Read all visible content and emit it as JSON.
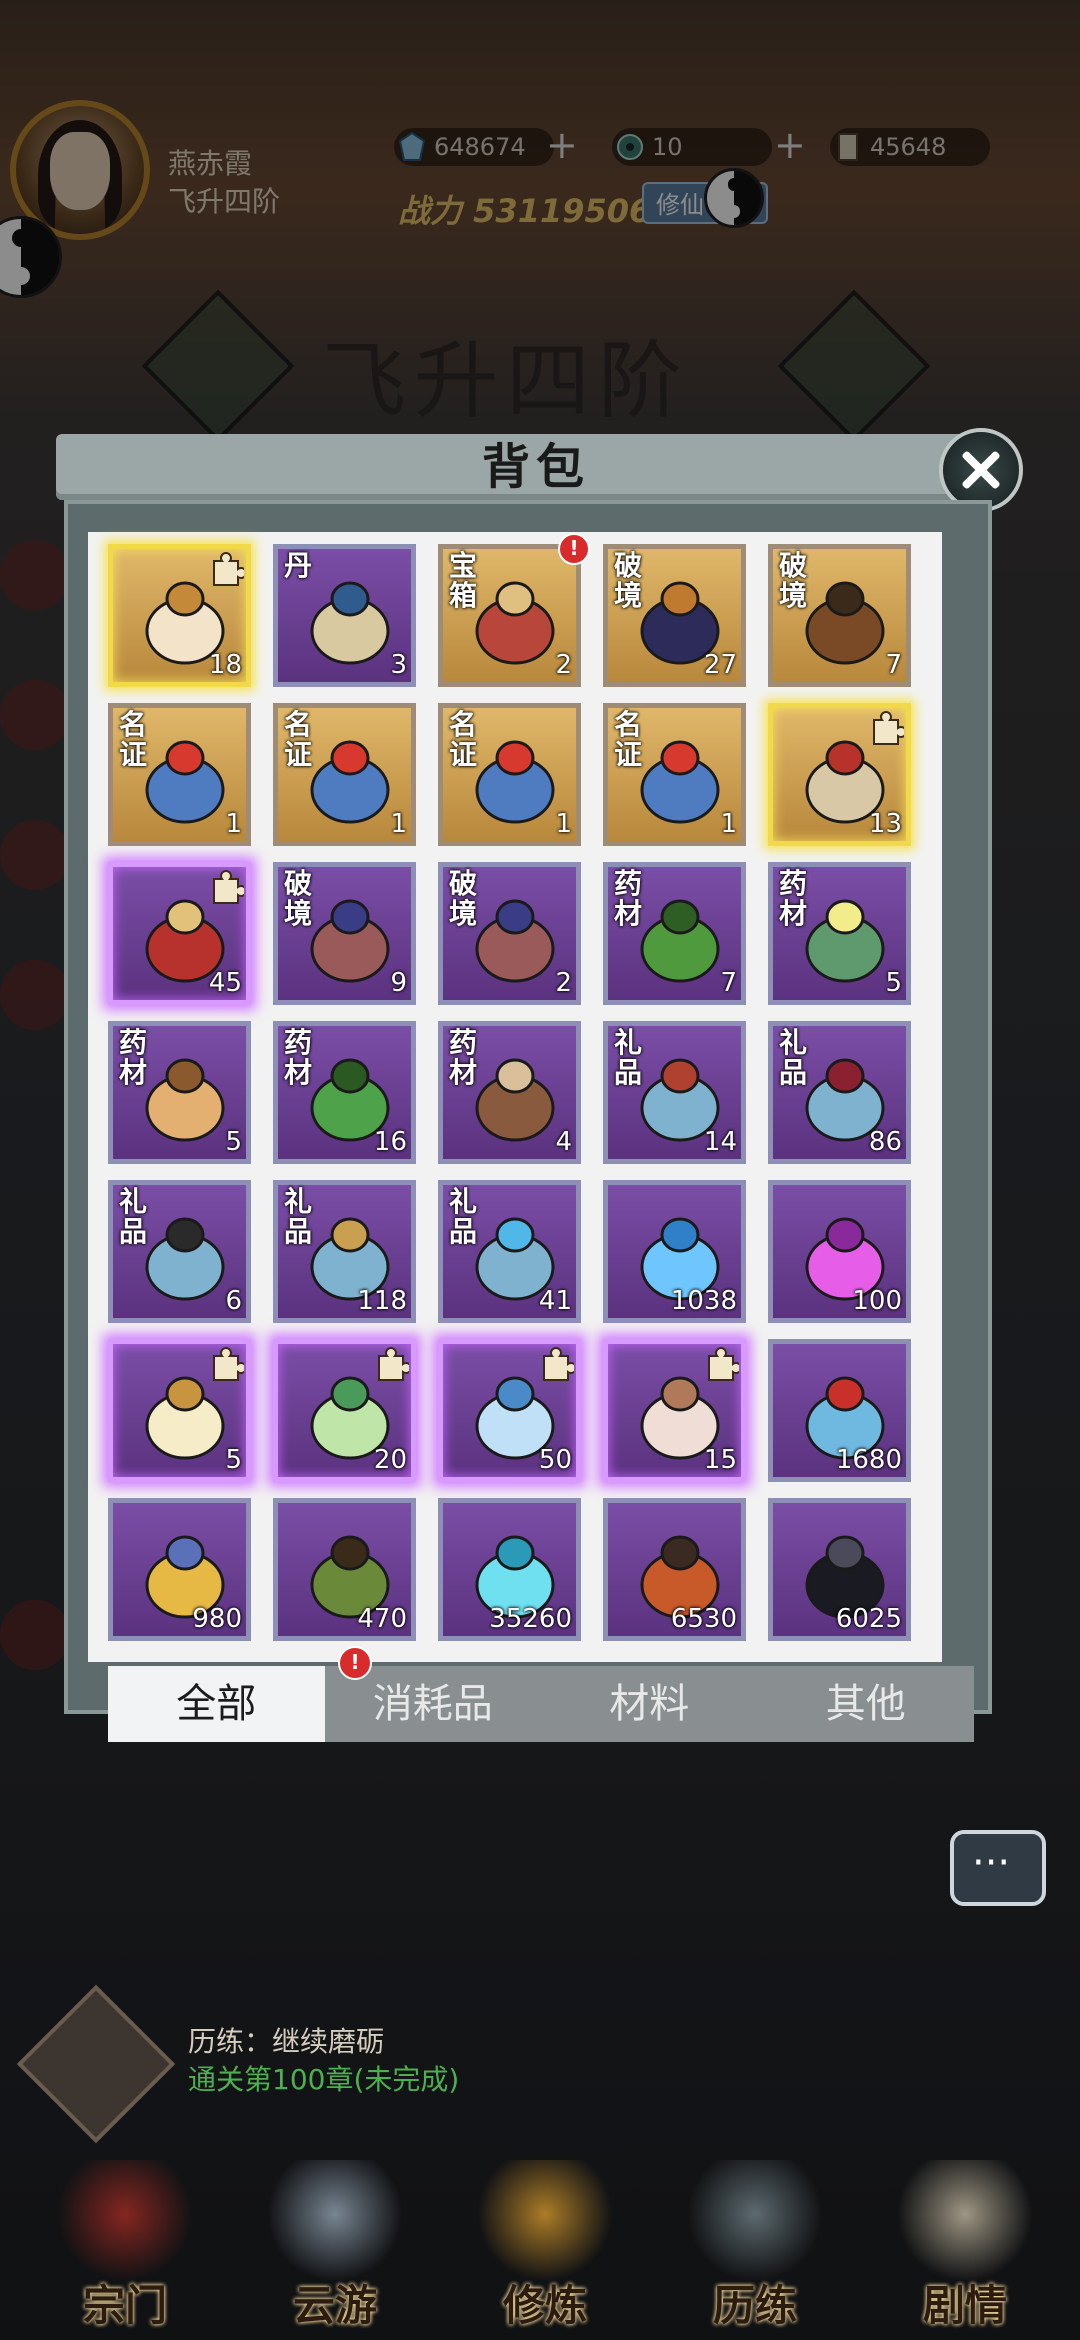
{
  "player": {
    "name": "燕赤霞",
    "rank": "飞升四阶"
  },
  "currency": [
    {
      "name": "spirit-stone",
      "value": "648674"
    },
    {
      "name": "jade",
      "value": "10"
    },
    {
      "name": "scroll",
      "value": "45648"
    }
  ],
  "power": {
    "label": "战力",
    "value": "53119506"
  },
  "cultivate_button": "修仙",
  "realm_title": "飞升四阶",
  "bag": {
    "title": "背包",
    "items": [
      {
        "tag": "",
        "count": "18",
        "rarity": "gold",
        "glow": true,
        "puzzle": true,
        "badge": false,
        "icon": "golden-gourd-icon"
      },
      {
        "tag": "丹",
        "count": "3",
        "rarity": "purple",
        "glow": false,
        "puzzle": false,
        "badge": false,
        "icon": "pill-box-icon"
      },
      {
        "tag": "宝箱",
        "count": "2",
        "rarity": "gold",
        "glow": false,
        "puzzle": false,
        "badge": true,
        "icon": "treasure-chest-icon"
      },
      {
        "tag": "破境",
        "count": "27",
        "rarity": "gold",
        "glow": false,
        "puzzle": false,
        "badge": false,
        "icon": "dark-gourd-icon"
      },
      {
        "tag": "破境",
        "count": "7",
        "rarity": "gold",
        "glow": false,
        "puzzle": false,
        "badge": false,
        "icon": "brown-gourd-icon"
      },
      {
        "tag": "名证",
        "count": "1",
        "rarity": "gold",
        "glow": false,
        "puzzle": false,
        "badge": false,
        "icon": "name-banner-icon"
      },
      {
        "tag": "名证",
        "count": "1",
        "rarity": "gold",
        "glow": false,
        "puzzle": false,
        "badge": false,
        "icon": "name-banner-icon"
      },
      {
        "tag": "名证",
        "count": "1",
        "rarity": "gold",
        "glow": false,
        "puzzle": false,
        "badge": false,
        "icon": "name-banner-icon"
      },
      {
        "tag": "名证",
        "count": "1",
        "rarity": "gold",
        "glow": false,
        "puzzle": false,
        "badge": false,
        "icon": "name-banner-icon"
      },
      {
        "tag": "",
        "count": "13",
        "rarity": "gold",
        "glow": true,
        "puzzle": true,
        "badge": false,
        "icon": "book-icon"
      },
      {
        "tag": "",
        "count": "45",
        "rarity": "purple",
        "glow": true,
        "puzzle": true,
        "badge": false,
        "icon": "purple-chest-icon"
      },
      {
        "tag": "破境",
        "count": "9",
        "rarity": "purple",
        "glow": false,
        "puzzle": false,
        "badge": false,
        "icon": "crystal-orb-icon"
      },
      {
        "tag": "破境",
        "count": "2",
        "rarity": "purple",
        "glow": false,
        "puzzle": false,
        "badge": false,
        "icon": "crystal-orb-icon"
      },
      {
        "tag": "药材",
        "count": "7",
        "rarity": "purple",
        "glow": false,
        "puzzle": false,
        "badge": false,
        "icon": "herb-leaf-icon"
      },
      {
        "tag": "药材",
        "count": "5",
        "rarity": "purple",
        "glow": false,
        "puzzle": false,
        "badge": false,
        "icon": "lotus-herb-icon"
      },
      {
        "tag": "药材",
        "count": "5",
        "rarity": "purple",
        "glow": false,
        "puzzle": false,
        "badge": false,
        "icon": "mushroom-icon"
      },
      {
        "tag": "药材",
        "count": "16",
        "rarity": "purple",
        "glow": false,
        "puzzle": false,
        "badge": false,
        "icon": "sprout-icon"
      },
      {
        "tag": "药材",
        "count": "4",
        "rarity": "purple",
        "glow": false,
        "puzzle": false,
        "badge": false,
        "icon": "seeds-icon"
      },
      {
        "tag": "礼品",
        "count": "14",
        "rarity": "purple",
        "glow": false,
        "puzzle": false,
        "badge": false,
        "icon": "gift-box-icon"
      },
      {
        "tag": "礼品",
        "count": "86",
        "rarity": "purple",
        "glow": false,
        "puzzle": false,
        "badge": false,
        "icon": "vase-box-icon"
      },
      {
        "tag": "礼品",
        "count": "6",
        "rarity": "purple",
        "glow": false,
        "puzzle": false,
        "badge": false,
        "icon": "spear-box-icon"
      },
      {
        "tag": "礼品",
        "count": "118",
        "rarity": "purple",
        "glow": false,
        "puzzle": false,
        "badge": false,
        "icon": "beast-box-icon"
      },
      {
        "tag": "礼品",
        "count": "41",
        "rarity": "purple",
        "glow": false,
        "puzzle": false,
        "badge": false,
        "icon": "crystal-box-icon"
      },
      {
        "tag": "",
        "count": "1038",
        "rarity": "purple",
        "glow": false,
        "puzzle": false,
        "badge": false,
        "icon": "blue-flame-icon"
      },
      {
        "tag": "",
        "count": "100",
        "rarity": "purple",
        "glow": false,
        "puzzle": false,
        "badge": false,
        "icon": "wolf-spirit-icon"
      },
      {
        "tag": "",
        "count": "5",
        "rarity": "purple",
        "glow": true,
        "puzzle": true,
        "badge": false,
        "icon": "cream-orb-icon"
      },
      {
        "tag": "",
        "count": "20",
        "rarity": "purple",
        "glow": true,
        "puzzle": true,
        "badge": false,
        "icon": "green-orb-icon"
      },
      {
        "tag": "",
        "count": "50",
        "rarity": "purple",
        "glow": true,
        "puzzle": true,
        "badge": false,
        "icon": "blue-orb-icon"
      },
      {
        "tag": "",
        "count": "15",
        "rarity": "purple",
        "glow": true,
        "puzzle": true,
        "badge": false,
        "icon": "pink-orb-icon"
      },
      {
        "tag": "",
        "count": "1680",
        "rarity": "purple",
        "glow": false,
        "puzzle": false,
        "badge": false,
        "icon": "ice-crystal-icon"
      },
      {
        "tag": "",
        "count": "980",
        "rarity": "purple",
        "glow": false,
        "puzzle": false,
        "badge": false,
        "icon": "gold-ore-icon"
      },
      {
        "tag": "",
        "count": "470",
        "rarity": "purple",
        "glow": false,
        "puzzle": false,
        "badge": false,
        "icon": "wood-log-icon"
      },
      {
        "tag": "",
        "count": "35260",
        "rarity": "purple",
        "glow": false,
        "puzzle": false,
        "badge": false,
        "icon": "water-drop-icon"
      },
      {
        "tag": "",
        "count": "6530",
        "rarity": "purple",
        "glow": false,
        "puzzle": false,
        "badge": false,
        "icon": "lava-rock-icon"
      },
      {
        "tag": "",
        "count": "6025",
        "rarity": "purple",
        "glow": false,
        "puzzle": false,
        "badge": false,
        "icon": "black-claw-icon"
      }
    ],
    "tabs": [
      {
        "label": "全部",
        "active": true,
        "badge": true
      },
      {
        "label": "消耗品",
        "active": false,
        "badge": false
      },
      {
        "label": "材料",
        "active": false,
        "badge": false
      },
      {
        "label": "其他",
        "active": false,
        "badge": false
      }
    ]
  },
  "badge_mark": "!",
  "quest": {
    "title": "历练：继续磨砺",
    "subtitle": "通关第100章(未完成)"
  },
  "nav": [
    {
      "label": "宗门",
      "icon": "sect-pagoda-icon"
    },
    {
      "label": "云游",
      "icon": "mountain-travel-icon"
    },
    {
      "label": "修炼",
      "icon": "cultivate-cauldron-icon"
    },
    {
      "label": "历练",
      "icon": "trial-scroll-icon"
    },
    {
      "label": "剧情",
      "icon": "story-scroll-icon"
    }
  ],
  "colors": {
    "gold_slot": "#c89a4d",
    "purple_slot": "#6a3f92",
    "badge": "#d92b2b",
    "quest_green": "#4caf50"
  }
}
